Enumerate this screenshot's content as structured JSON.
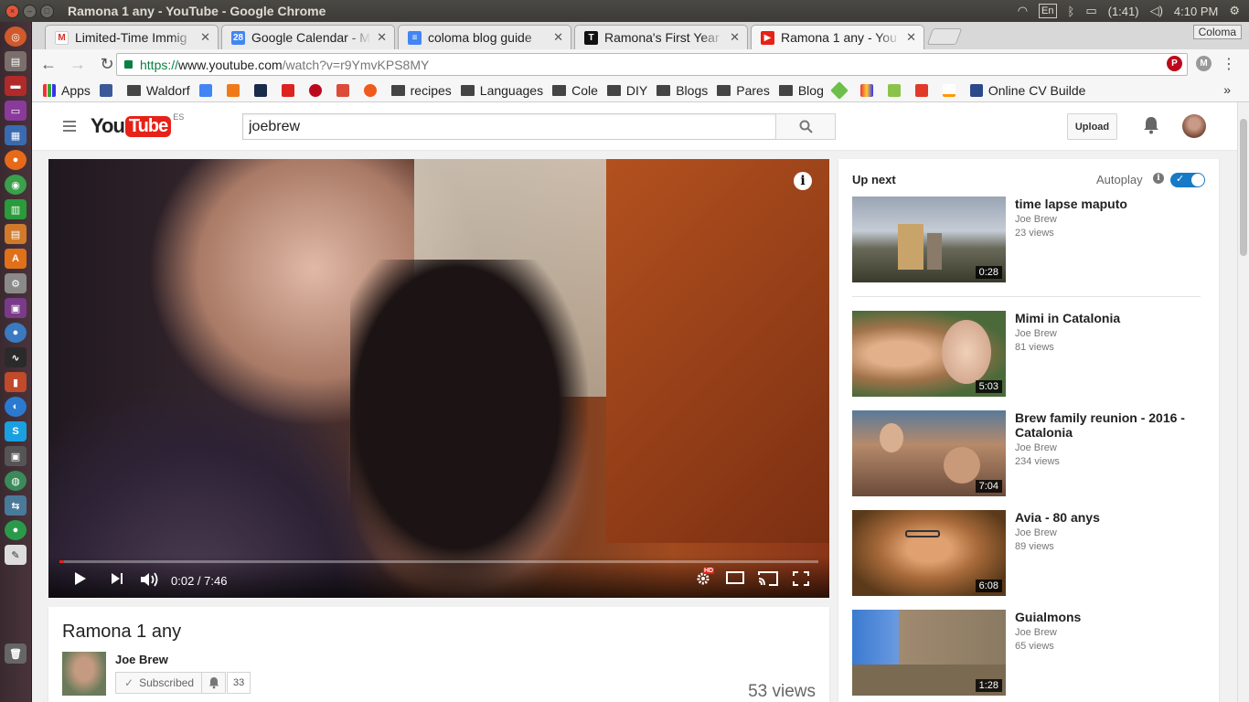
{
  "os": {
    "window_title": "Ramona 1 any - YouTube - Google Chrome",
    "keyboard": "En",
    "battery": "(1:41)",
    "clock": "4:10 PM"
  },
  "tabs": [
    {
      "label": "Limited-Time Immig",
      "favicon": "gmail-icon",
      "color": "#d93025"
    },
    {
      "label": "Google Calendar - M",
      "favicon": "calendar-icon",
      "color": "#4285f4",
      "badge": "28"
    },
    {
      "label": "coloma blog guide",
      "favicon": "docs-icon",
      "color": "#4285f4"
    },
    {
      "label": "Ramona's First Year",
      "favicon": "t-icon",
      "color": "#111111",
      "badge": "T"
    },
    {
      "label": "Ramona 1 any - You",
      "favicon": "youtube-icon",
      "color": "#e62117",
      "active": true
    }
  ],
  "profile_name": "Coloma",
  "toolbar": {
    "url_scheme": "https://",
    "url_host": "www.youtube.com",
    "url_path": "/watch?v=r9YmvKPS8MY"
  },
  "bookmarks": [
    {
      "label": "Apps",
      "icon": "apps-icon"
    },
    {
      "label": "",
      "icon": "facebook-icon"
    },
    {
      "label": "Waldorf",
      "icon": "folder-icon"
    },
    {
      "label": "",
      "icon": "translate-icon"
    },
    {
      "label": "",
      "icon": "cx-icon"
    },
    {
      "label": "",
      "icon": "x-icon"
    },
    {
      "label": "",
      "icon": "plane-icon"
    },
    {
      "label": "",
      "icon": "pinterest-icon"
    },
    {
      "label": "",
      "icon": "gplus-icon"
    },
    {
      "label": "",
      "icon": "orange-icon"
    },
    {
      "label": "recipes",
      "icon": "folder-icon"
    },
    {
      "label": "Languages",
      "icon": "folder-icon"
    },
    {
      "label": "Cole",
      "icon": "folder-icon"
    },
    {
      "label": "DIY",
      "icon": "folder-icon"
    },
    {
      "label": "Blogs",
      "icon": "folder-icon"
    },
    {
      "label": "Pares",
      "icon": "folder-icon"
    },
    {
      "label": "Blog",
      "icon": "folder-icon"
    },
    {
      "label": "",
      "icon": "feedly-icon"
    },
    {
      "label": "",
      "icon": "gift-icon"
    },
    {
      "label": "",
      "icon": "android-icon"
    },
    {
      "label": "",
      "icon": "red-icon"
    },
    {
      "label": "",
      "icon": "amazon-icon"
    },
    {
      "label": "Online CV Builde",
      "icon": "cv-icon"
    }
  ],
  "youtube": {
    "logo_you": "You",
    "logo_tube": "Tube",
    "logo_region": "ES",
    "search_value": "joebrew",
    "upload_label": "Upload"
  },
  "player": {
    "time": "0:02 / 7:46",
    "progress_fraction": 0.004,
    "info_glyph": "i",
    "hd_badge": "HD"
  },
  "video": {
    "title": "Ramona 1 any",
    "channel": "Joe Brew",
    "subscribed_label": "Subscribed",
    "subscriber_count": "33",
    "views": "53 views"
  },
  "sidebar": {
    "up_next": "Up next",
    "autoplay": "Autoplay",
    "autoplay_on": true,
    "recommendations": [
      {
        "title": "time lapse maputo",
        "channel": "Joe Brew",
        "views": "23 views",
        "duration": "0:28"
      },
      {
        "title": "Mimi in Catalonia",
        "channel": "Joe Brew",
        "views": "81 views",
        "duration": "5:03"
      },
      {
        "title": "Brew family reunion - 2016 - Catalonia",
        "channel": "Joe Brew",
        "views": "234 views",
        "duration": "7:04"
      },
      {
        "title": "Avia - 80 anys",
        "channel": "Joe Brew",
        "views": "89 views",
        "duration": "6:08"
      },
      {
        "title": "Guialmons",
        "channel": "Joe Brew",
        "views": "65 views",
        "duration": "1:28"
      }
    ]
  }
}
